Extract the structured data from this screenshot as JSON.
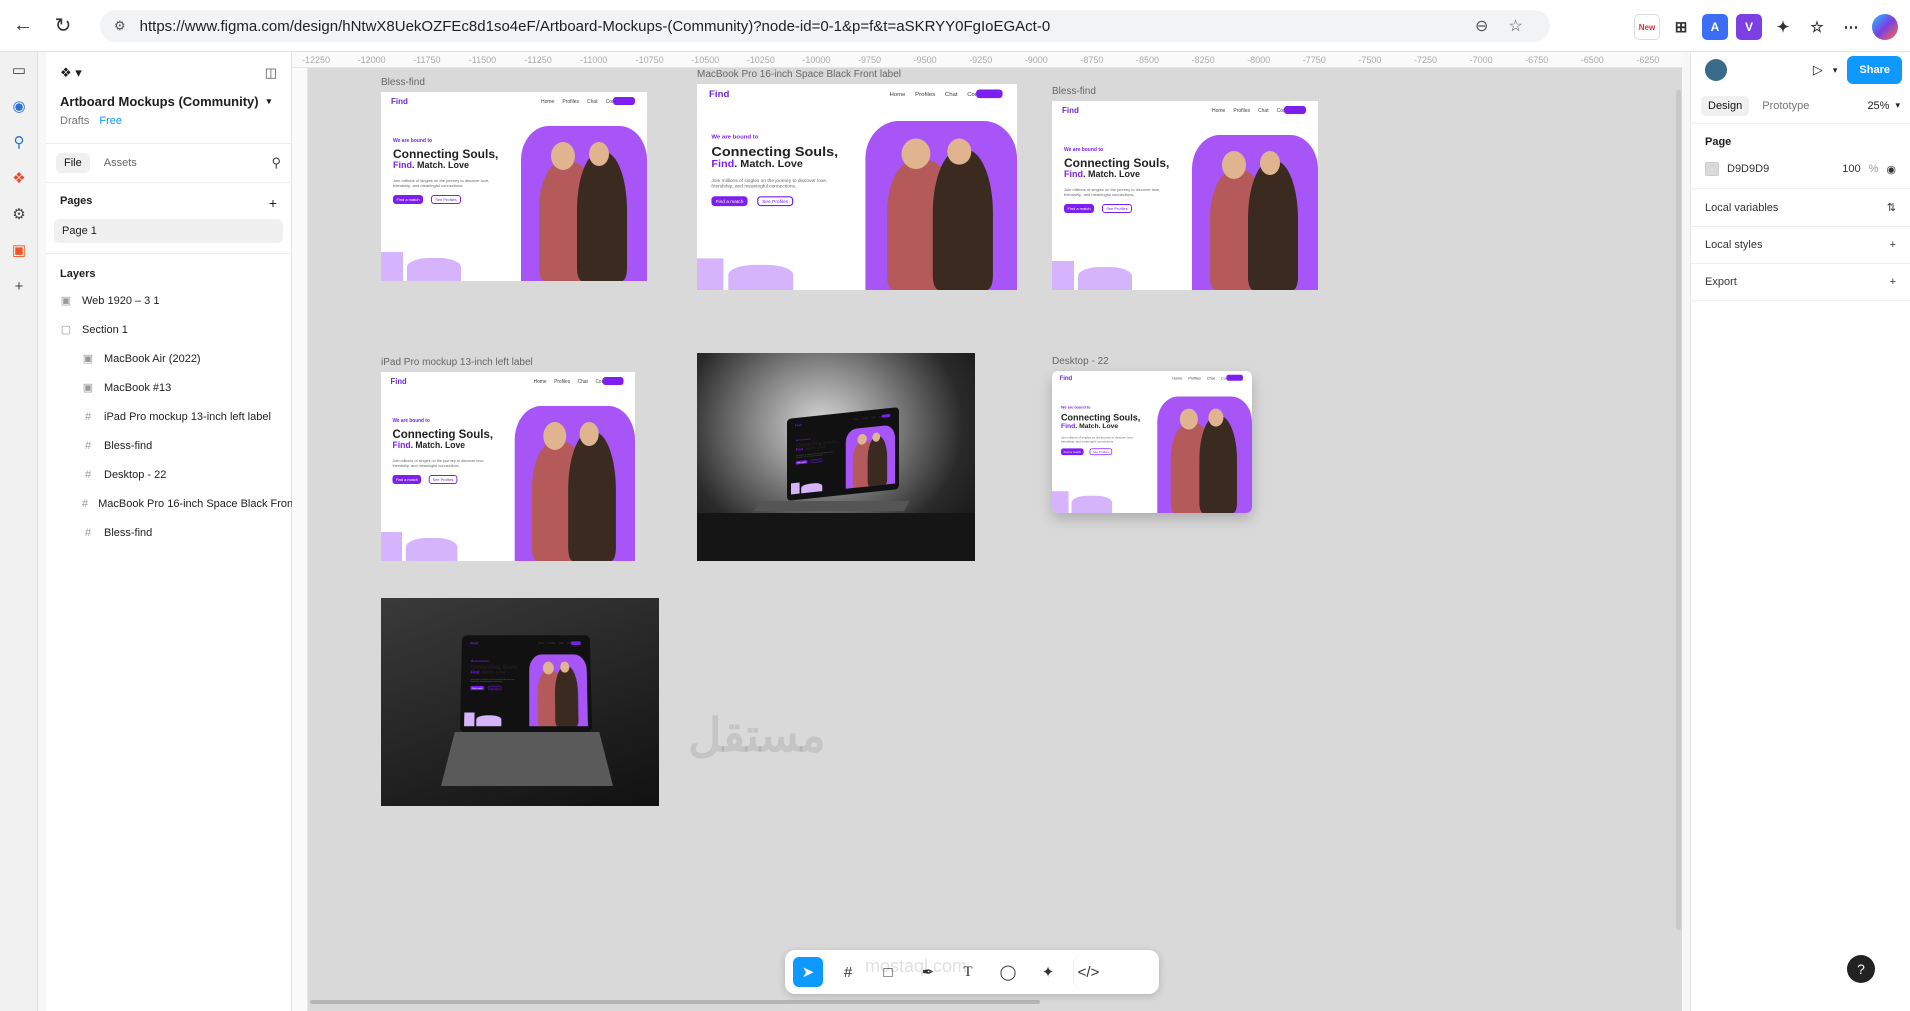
{
  "browser": {
    "url": "https://www.figma.com/design/hNtwX8UekOZFEc8d1so4eF/Artboard-Mockups-(Community)?node-id=0-1&p=f&t=aSKRYY0FgIoEGAct-0",
    "new_badge": "New"
  },
  "file": {
    "title": "Artboard Mockups (Community)",
    "location": "Drafts",
    "plan": "Free"
  },
  "left_tabs": [
    "File",
    "Assets"
  ],
  "pages": {
    "header": "Pages",
    "items": [
      "Page 1"
    ]
  },
  "layers": {
    "header": "Layers",
    "items": [
      {
        "label": "Web 1920 – 3 1",
        "indent": false,
        "icon": "image-icon"
      },
      {
        "label": "Section 1",
        "indent": false,
        "icon": "section-icon"
      },
      {
        "label": "MacBook Air (2022)",
        "indent": true,
        "icon": "image-icon"
      },
      {
        "label": "MacBook #13",
        "indent": true,
        "icon": "image-icon"
      },
      {
        "label": "iPad Pro mockup 13-inch left label",
        "indent": true,
        "icon": "frame-icon"
      },
      {
        "label": "Bless-find",
        "indent": true,
        "icon": "frame-icon"
      },
      {
        "label": "Desktop - 22",
        "indent": true,
        "icon": "frame-icon"
      },
      {
        "label": "MacBook Pro 16-inch Space Black Front",
        "indent": true,
        "icon": "frame-icon"
      },
      {
        "label": "Bless-find",
        "indent": true,
        "icon": "frame-icon"
      }
    ]
  },
  "ruler": [
    "-12250",
    "-12000",
    "-11750",
    "-11500",
    "-11250",
    "-11000",
    "-10750",
    "-10500",
    "-10250",
    "-10000",
    "-9750",
    "-9500",
    "-9250",
    "-9000",
    "-8750",
    "-8500",
    "-8250",
    "-8000",
    "-7750",
    "-7500",
    "-7250",
    "-7000",
    "-6750",
    "-6500",
    "-6250"
  ],
  "canvas": {
    "frames": [
      {
        "label": "Bless-find"
      },
      {
        "label": "MacBook Pro 16-inch Space Black Front label"
      },
      {
        "label": "Bless-find"
      },
      {
        "label": "iPad Pro mockup 13-inch left label"
      },
      {
        "label": ""
      },
      {
        "label": "Desktop - 22"
      }
    ],
    "mockup": {
      "logo": "Find",
      "nav": [
        "Home",
        "Profiles",
        "Chat",
        "Contact us"
      ],
      "login": "Log In",
      "tag": "We are bound to",
      "h1_line1": "Connecting Souls,",
      "h1_find": "Find",
      "h1_rest": ". Match. Love",
      "sub": "Join millions of singles on the journey to discover love, friendship, and meaningful connections.",
      "btn1": "Find a match",
      "btn2": "See Profiles",
      "accent": "#7c1ff0"
    }
  },
  "right_panel": {
    "share": "Share",
    "tabs": [
      "Design",
      "Prototype"
    ],
    "zoom": "25%",
    "page_header": "Page",
    "page_color": "D9D9D9",
    "opacity": "100",
    "opacity_unit": "%",
    "local_variables": "Local variables",
    "local_styles": "Local styles",
    "export": "Export"
  },
  "watermark": {
    "arabic": "مستقل",
    "latin": "mostaql.com"
  }
}
